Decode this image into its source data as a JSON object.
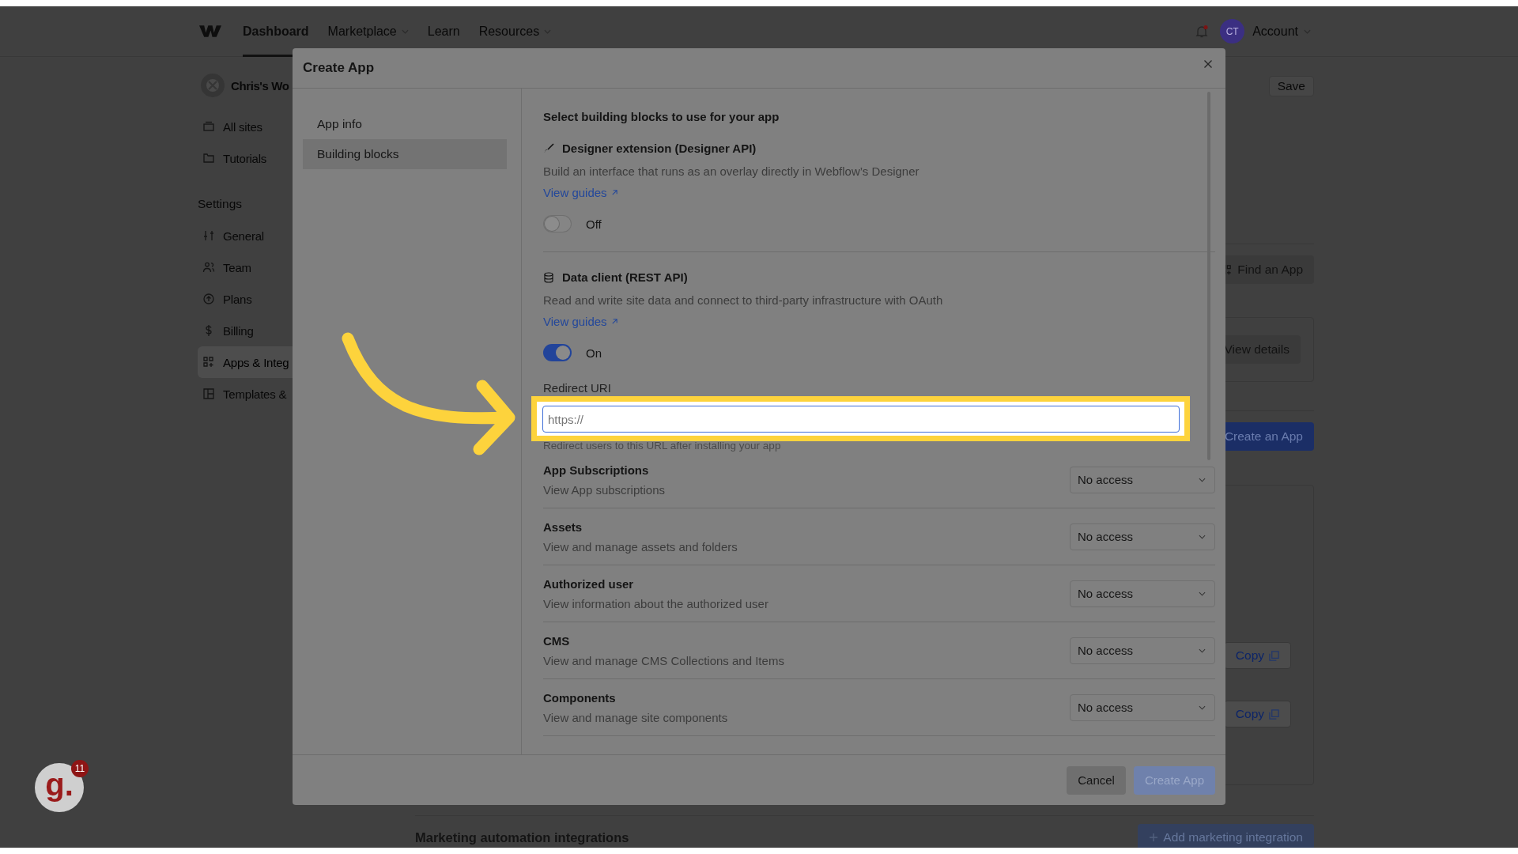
{
  "top_nav": {
    "links": [
      {
        "label": "Dashboard",
        "selected": true,
        "dropdown": false
      },
      {
        "label": "Marketplace",
        "selected": false,
        "dropdown": true
      },
      {
        "label": "Learn",
        "selected": false,
        "dropdown": false
      },
      {
        "label": "Resources",
        "selected": false,
        "dropdown": true
      }
    ],
    "avatar": "CT",
    "account": "Account"
  },
  "sidebar": {
    "workspace": "Chris's Wo",
    "items": [
      {
        "label": "All sites",
        "selected": false
      },
      {
        "label": "Tutorials",
        "selected": false
      }
    ],
    "section": "Settings",
    "settings_items": [
      {
        "label": "General",
        "selected": false
      },
      {
        "label": "Team",
        "selected": false
      },
      {
        "label": "Plans",
        "selected": false
      },
      {
        "label": "Billing",
        "selected": false
      },
      {
        "label": "Apps & Integ",
        "selected": true
      },
      {
        "label": "Templates &",
        "selected": false
      }
    ]
  },
  "background": {
    "save": "Save",
    "find_app": "Find an App",
    "view_details": "View details",
    "create_app": "Create an App",
    "copy_buttons": [
      "Copy",
      "Copy"
    ],
    "marketing_heading": "Marketing automation integrations",
    "add_marketing": "Add marketing integration"
  },
  "modal": {
    "title": "Create App",
    "nav": [
      {
        "label": "App info",
        "selected": false
      },
      {
        "label": "Building blocks",
        "selected": true
      }
    ],
    "heading": "Select building blocks to use for your app",
    "blocks": [
      {
        "title": "Designer extension (Designer API)",
        "description": "Build an interface that runs as an overlay directly in Webflow’s Designer",
        "link": "View guides",
        "on": false,
        "state_label": "Off"
      },
      {
        "title": "Data client (REST API)",
        "description": "Read and write site data and connect to third-party infrastructure with OAuth",
        "link": "View guides",
        "on": true,
        "state_label": "On"
      }
    ],
    "redirect": {
      "label": "Redirect URI",
      "placeholder": "https://",
      "hint": "Redirect users to this URL after installing your app"
    },
    "permissions": [
      {
        "name": "App Subscriptions",
        "description": "View App subscriptions",
        "value": "No access"
      },
      {
        "name": "Assets",
        "description": "View and manage assets and folders",
        "value": "No access"
      },
      {
        "name": "Authorized user",
        "description": "View information about the authorized user",
        "value": "No access"
      },
      {
        "name": "CMS",
        "description": "View and manage CMS Collections and Items",
        "value": "No access"
      },
      {
        "name": "Components",
        "description": "View and manage site components",
        "value": "No access"
      }
    ],
    "cancel": "Cancel",
    "create": {
      "label": "Create App",
      "disabled": true
    }
  },
  "help_widget": {
    "logo": "g.",
    "badge": "11"
  }
}
